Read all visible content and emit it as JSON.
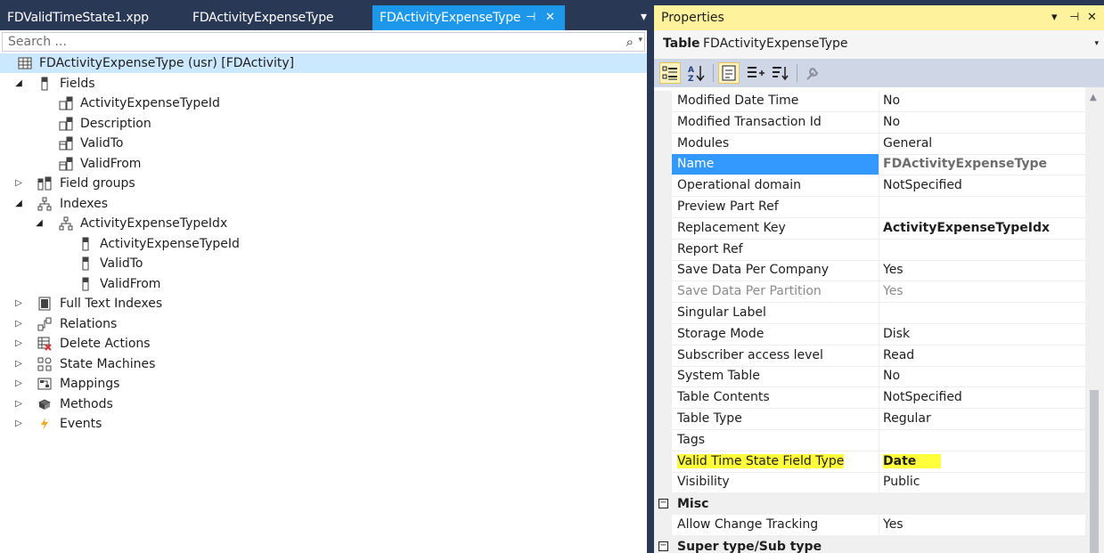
{
  "tabs": [
    {
      "label": "FDValidTimeState1.xpp",
      "active": false
    },
    {
      "label": "FDActivityExpenseType",
      "active": false
    },
    {
      "label": "FDActivityExpenseType",
      "active": true
    }
  ],
  "tab_pin_glyph": "⊣",
  "tab_close_glyph": "✕",
  "tabs_menu_glyph": "▾",
  "search": {
    "placeholder": "Search ...",
    "value": ""
  },
  "tree": [
    {
      "label": "FDActivityExpenseType (usr) [FDActivity]",
      "icon": "table-icon",
      "expander": ""
    },
    {
      "label": "Fields",
      "icon": "field-icon",
      "expander": "◢"
    },
    {
      "label": "ActivityExpenseTypeId",
      "icon": "field-string-icon",
      "expander": ""
    },
    {
      "label": "Description",
      "icon": "field-string-icon",
      "expander": ""
    },
    {
      "label": "ValidTo",
      "icon": "field-date-icon",
      "expander": ""
    },
    {
      "label": "ValidFrom",
      "icon": "field-date-icon",
      "expander": ""
    },
    {
      "label": "Field groups",
      "icon": "field-group-icon",
      "expander": "▷"
    },
    {
      "label": "Indexes",
      "icon": "index-icon",
      "expander": "◢"
    },
    {
      "label": "ActivityExpenseTypeIdx",
      "icon": "index-icon",
      "expander": "◢"
    },
    {
      "label": "ActivityExpenseTypeId",
      "icon": "field-icon",
      "expander": ""
    },
    {
      "label": "ValidTo",
      "icon": "field-icon",
      "expander": ""
    },
    {
      "label": "ValidFrom",
      "icon": "field-icon",
      "expander": ""
    },
    {
      "label": "Full Text Indexes",
      "icon": "full-text-index-icon",
      "expander": "▷"
    },
    {
      "label": "Relations",
      "icon": "relation-icon",
      "expander": "▷"
    },
    {
      "label": "Delete Actions",
      "icon": "delete-action-icon",
      "expander": "▷"
    },
    {
      "label": "State Machines",
      "icon": "state-machine-icon",
      "expander": "▷"
    },
    {
      "label": "Mappings",
      "icon": "mapping-icon",
      "expander": "▷"
    },
    {
      "label": "Methods",
      "icon": "method-icon",
      "expander": "▷"
    },
    {
      "label": "Events",
      "icon": "event-icon",
      "expander": "▷"
    }
  ],
  "properties": {
    "title": "Properties",
    "object_kind": "Table",
    "object_name": "FDActivityExpenseType",
    "title_glyphs": {
      "menu": "▾",
      "pin": "⊣",
      "close": "✕"
    },
    "object_dropdown_glyph": "▾",
    "toolbar": [
      "categorized-icon",
      "alphabetical-icon",
      "properties-icon",
      "events-icon",
      "sort-icon",
      "property-pages-icon"
    ],
    "rows": [
      {
        "type": "prop",
        "name": "Modified Date Time",
        "value": "No"
      },
      {
        "type": "prop",
        "name": "Modified Transaction Id",
        "value": "No"
      },
      {
        "type": "prop",
        "name": "Modules",
        "value": "General"
      },
      {
        "type": "prop",
        "name": "Name",
        "value": "FDActivityExpenseType",
        "state": "selected"
      },
      {
        "type": "prop",
        "name": "Operational domain",
        "value": "NotSpecified"
      },
      {
        "type": "prop",
        "name": "Preview Part Ref",
        "value": ""
      },
      {
        "type": "prop",
        "name": "Replacement Key",
        "value": "ActivityExpenseTypeIdx",
        "state": "bold"
      },
      {
        "type": "prop",
        "name": "Report Ref",
        "value": ""
      },
      {
        "type": "prop",
        "name": "Save Data Per Company",
        "value": "Yes"
      },
      {
        "type": "prop",
        "name": "Save Data Per Partition",
        "value": "Yes",
        "state": "disabled"
      },
      {
        "type": "prop",
        "name": "Singular Label",
        "value": ""
      },
      {
        "type": "prop",
        "name": "Storage Mode",
        "value": "Disk"
      },
      {
        "type": "prop",
        "name": "Subscriber access level",
        "value": "Read"
      },
      {
        "type": "prop",
        "name": "System Table",
        "value": "No"
      },
      {
        "type": "prop",
        "name": "Table Contents",
        "value": "NotSpecified"
      },
      {
        "type": "prop",
        "name": "Table Type",
        "value": "Regular"
      },
      {
        "type": "prop",
        "name": "Tags",
        "value": ""
      },
      {
        "type": "prop",
        "name": "Valid Time State Field Type",
        "value": "Date",
        "state": "bold",
        "highlight": true
      },
      {
        "type": "prop",
        "name": "Visibility",
        "value": "Public"
      },
      {
        "type": "category",
        "name": "Misc",
        "glyph": "−"
      },
      {
        "type": "prop",
        "name": "Allow Change Tracking",
        "value": "Yes"
      },
      {
        "type": "category",
        "name": "Super type/Sub type",
        "glyph": "−"
      }
    ],
    "scroll_up_glyph": "▲"
  },
  "colors": {
    "chrome": "#293955",
    "active_tab": "#1c97ea",
    "properties_title": "#fff29d",
    "selection": "#3399ff",
    "highlight": "#ffff3c"
  }
}
